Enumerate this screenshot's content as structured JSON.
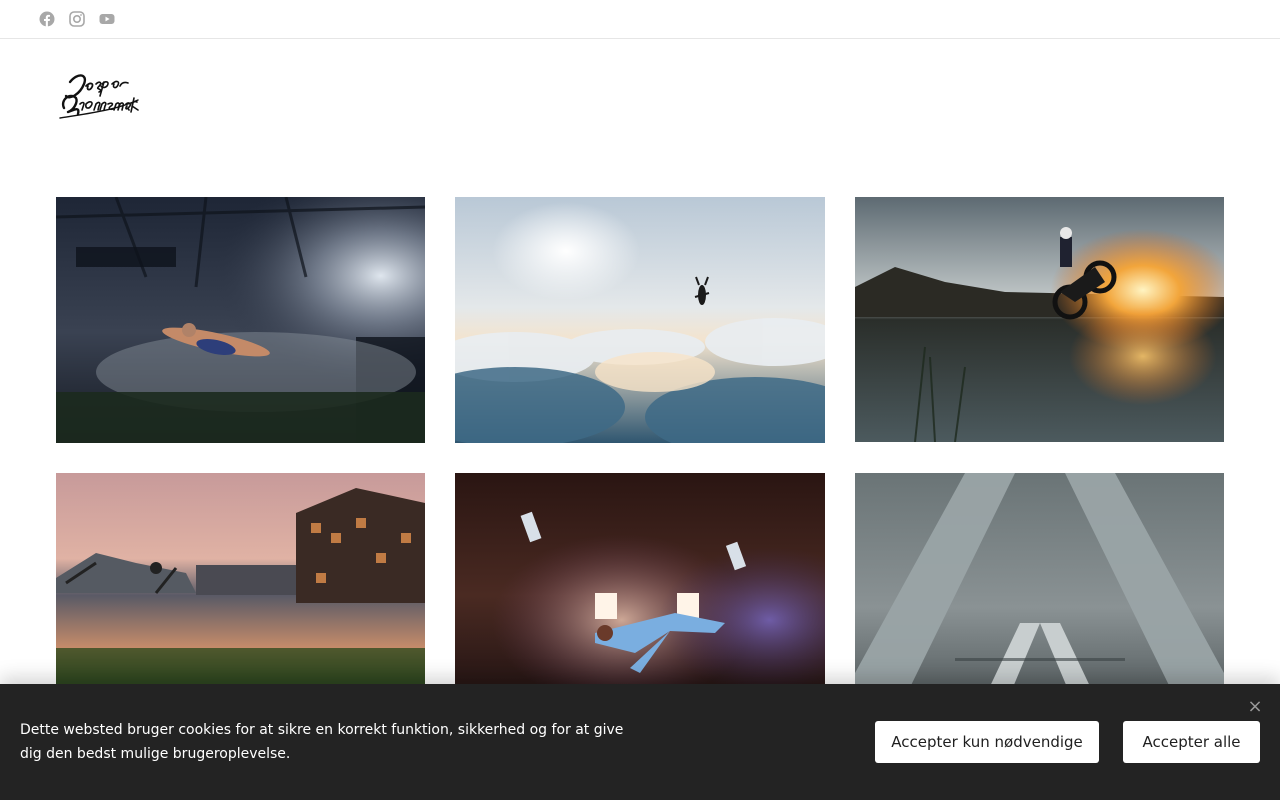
{
  "topbar": {
    "social": [
      {
        "icon": "facebook-icon",
        "label": "Facebook"
      },
      {
        "icon": "instagram-icon",
        "label": "Instagram"
      },
      {
        "icon": "youtube-icon",
        "label": "YouTube"
      }
    ],
    "icon_color": "#a8a8a8"
  },
  "logo": {
    "text_line1": "Jesper",
    "text_line2": "Grønnemark"
  },
  "gallery": {
    "items": [
      {
        "subject": "swimmer-in-hall"
      },
      {
        "subject": "skydiver-above-clouds"
      },
      {
        "subject": "motorcycle-wheelie-explosion"
      },
      {
        "subject": "bmx-rider-by-building"
      },
      {
        "subject": "dancer-in-barn"
      },
      {
        "subject": "concrete-structure"
      }
    ]
  },
  "cookie": {
    "text": "Dette websted bruger cookies for at sikre en korrekt funktion, sikkerhed og for at give dig den bedst mulige brugeroplevelse.",
    "accept_necessary": "Accepter kun nødvendige",
    "accept_all": "Accepter alle",
    "close": "×",
    "background": "#232323"
  }
}
